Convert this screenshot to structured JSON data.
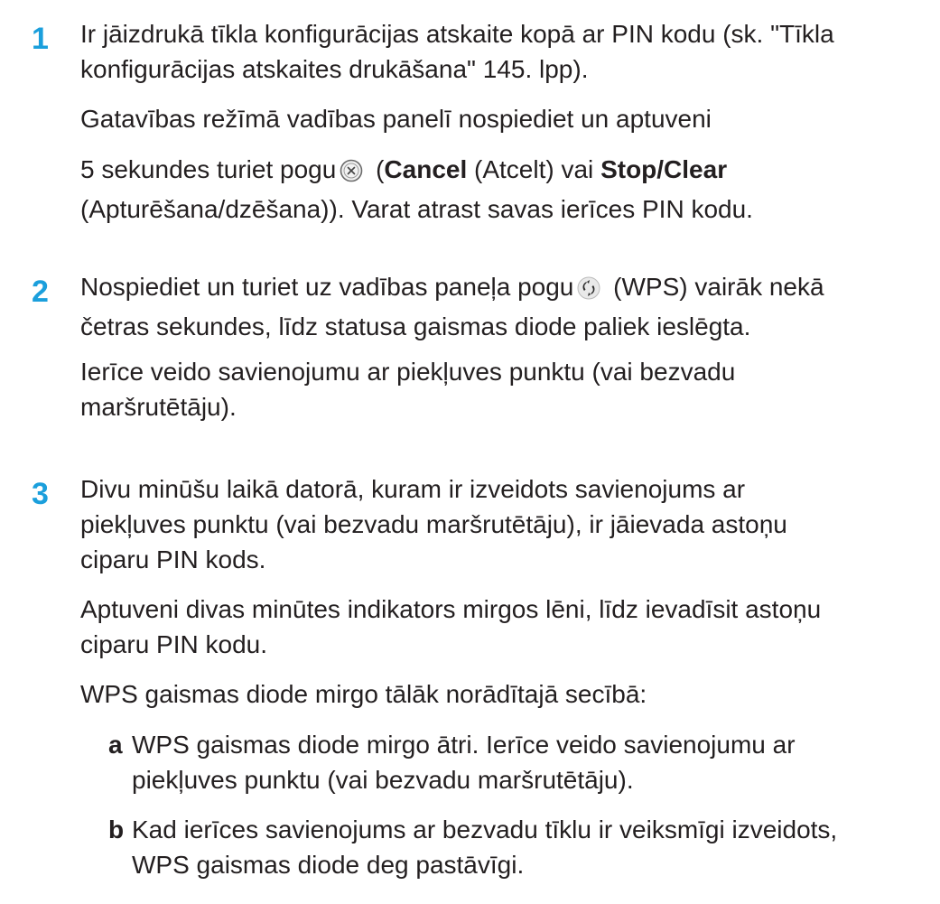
{
  "steps": [
    {
      "number": "1",
      "line1": "Ir jāizdrukā tīkla konfigurācijas atskaite kopā ar PIN kodu (sk. \"Tīkla",
      "line2": "konfigurācijas atskaites drukāšana\" 145. lpp).",
      "p2": "Gatavības režīmā vadības panelī nospiediet un aptuveni",
      "p3_pre": "5 sekundes turiet pogu",
      "p3_paren_open": " (",
      "p3_cancel": "Cancel",
      "p3_mid": " (Atcelt) vai ",
      "p3_stop": "Stop/Clear",
      "p3_line2": "(Apturēšana/dzēšana)). Varat atrast savas ierīces PIN kodu.",
      "icon": "cancel-circle-x-icon"
    },
    {
      "number": "2",
      "line1_pre": "Nospiediet un turiet uz vadības paneļa pogu",
      "line1_post": " (WPS) vairāk nekā",
      "line2": "četras sekundes, līdz statusa gaismas diode paliek ieslēgta.",
      "p2_line1": "Ierīce veido savienojumu ar piekļuves punktu (vai bezvadu",
      "p2_line2": "maršrutētāju).",
      "icon": "wps-icon"
    },
    {
      "number": "3",
      "line1": "Divu minūšu laikā datorā, kuram ir izveidots savienojums ar",
      "line2": "piekļuves punktu (vai bezvadu maršrutētāju), ir jāievada astoņu",
      "line3": "ciparu PIN kods.",
      "p2_line1": "Aptuveni divas minūtes indikators mirgos lēni, līdz ievadīsit astoņu",
      "p2_line2": "ciparu PIN kodu.",
      "p3": "WPS gaismas diode mirgo tālāk norādītajā secībā:",
      "subitems": [
        {
          "letter": "a",
          "line1": "WPS gaismas diode mirgo ātri. Ierīce veido savienojumu ar",
          "line2": "piekļuves punktu (vai bezvadu maršrutētāju)."
        },
        {
          "letter": "b",
          "line1": "Kad ierīces savienojums ar bezvadu tīklu ir veiksmīgi izveidots,",
          "line2": "WPS gaismas diode deg pastāvīgi."
        }
      ]
    }
  ],
  "colors": {
    "step_number": "#1b9fdc",
    "text": "#231f20"
  }
}
